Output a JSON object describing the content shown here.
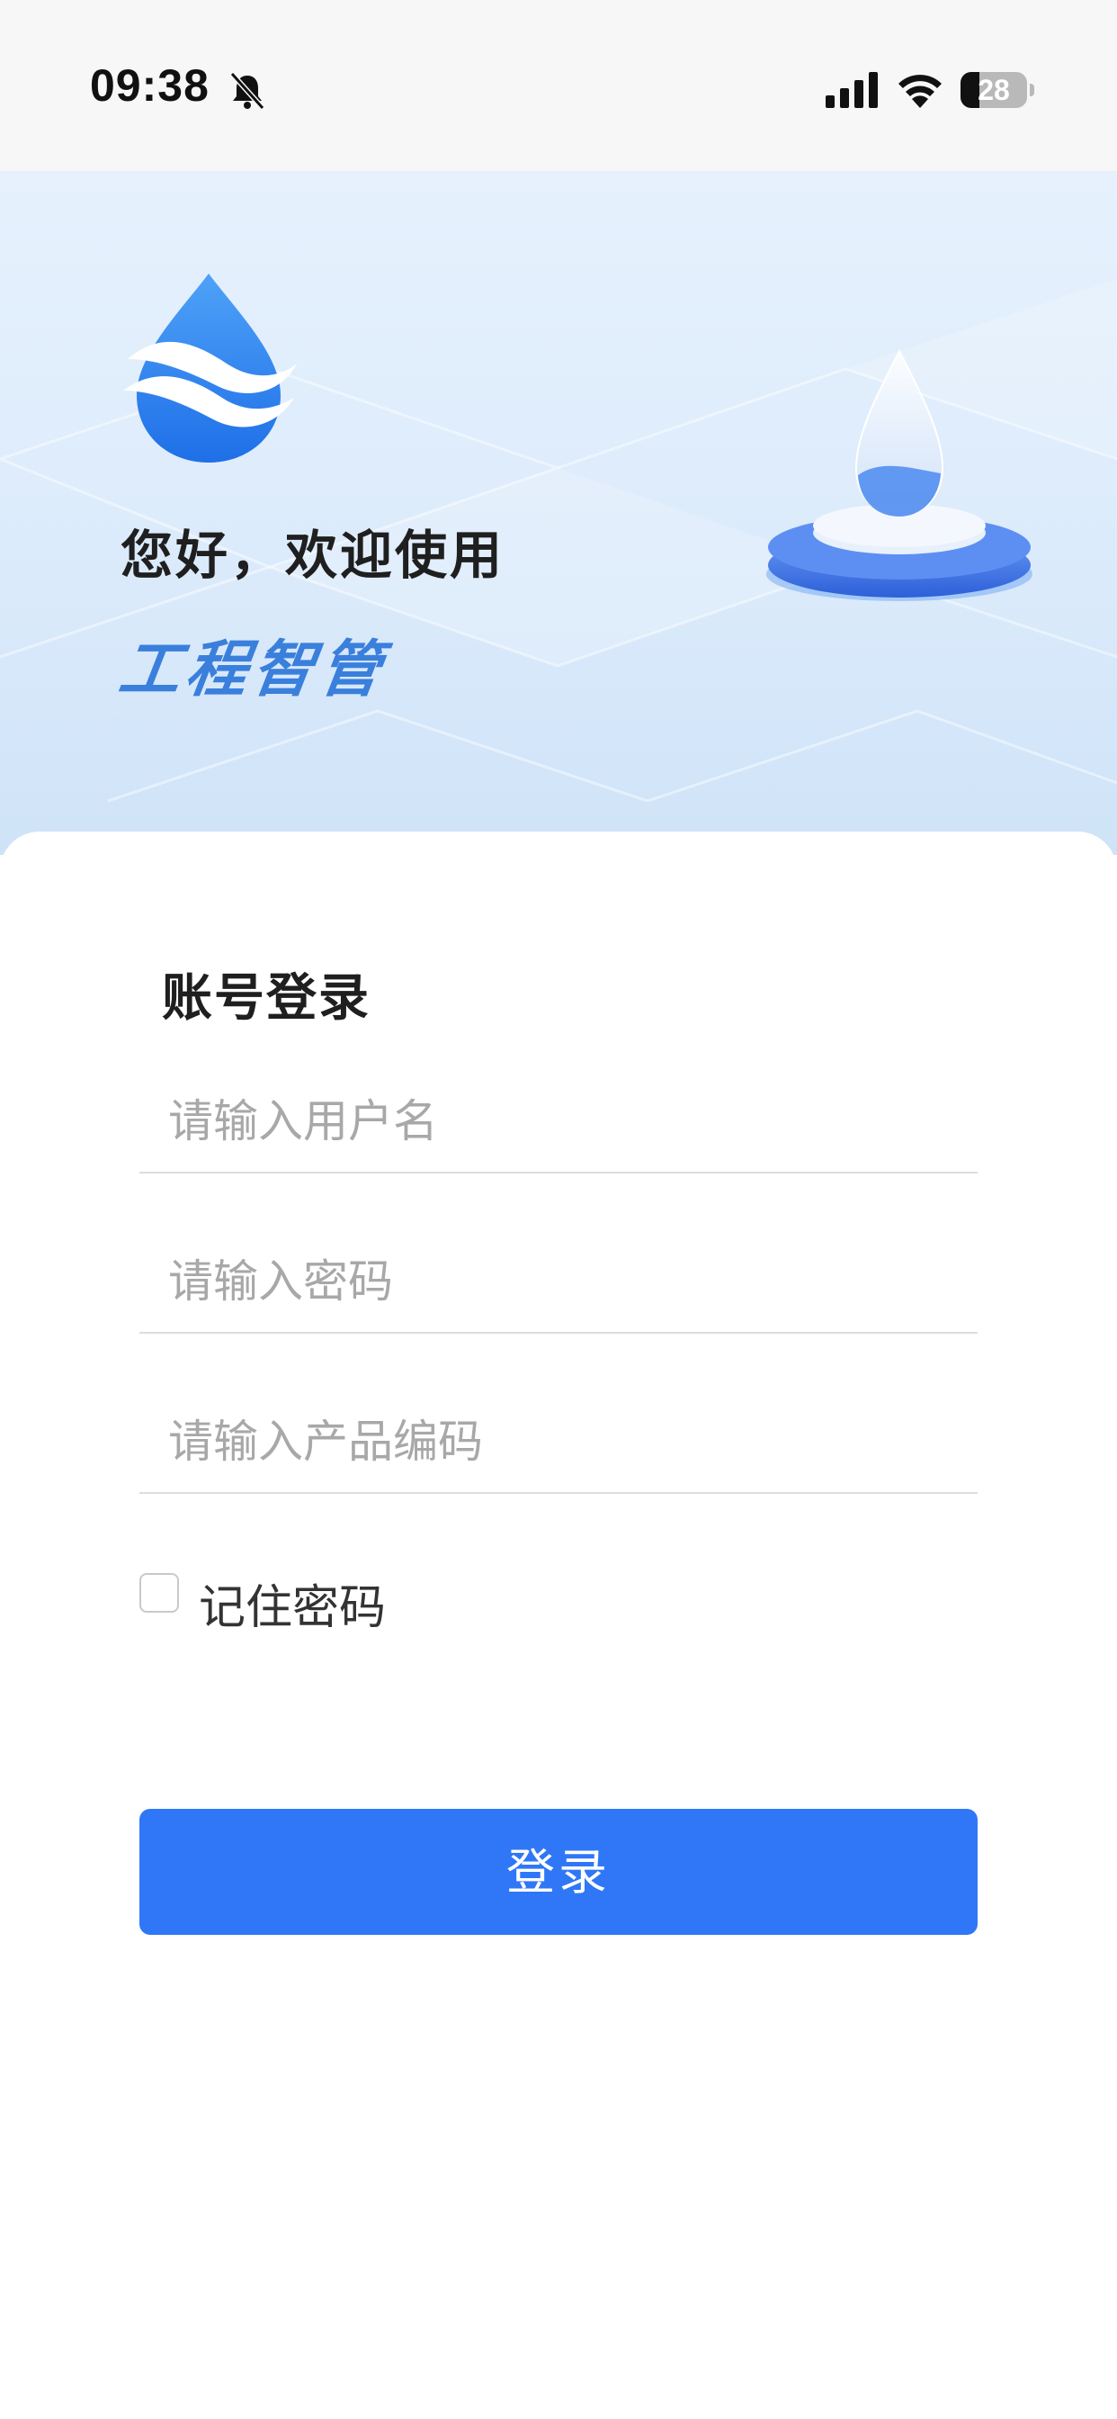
{
  "status_bar": {
    "time": "09:38",
    "battery_level": "28",
    "icons": [
      "bell-muted-icon",
      "signal-icon",
      "wifi-icon",
      "battery-icon"
    ]
  },
  "hero": {
    "welcome": "您好，欢迎使用",
    "app_name": "工程智管",
    "icons": [
      "water-drop-logo-icon",
      "water-drop-platform-icon"
    ],
    "colors": {
      "brand_blue": "#2f77f6",
      "app_name_blue": "#3a7fdc"
    }
  },
  "login": {
    "title": "账号登录",
    "username_placeholder": "请输入用户名",
    "password_placeholder": "请输入密码",
    "product_code_placeholder": "请输入产品编码",
    "remember_label": "记住密码",
    "remember_checked": false,
    "submit_label": "登录"
  }
}
